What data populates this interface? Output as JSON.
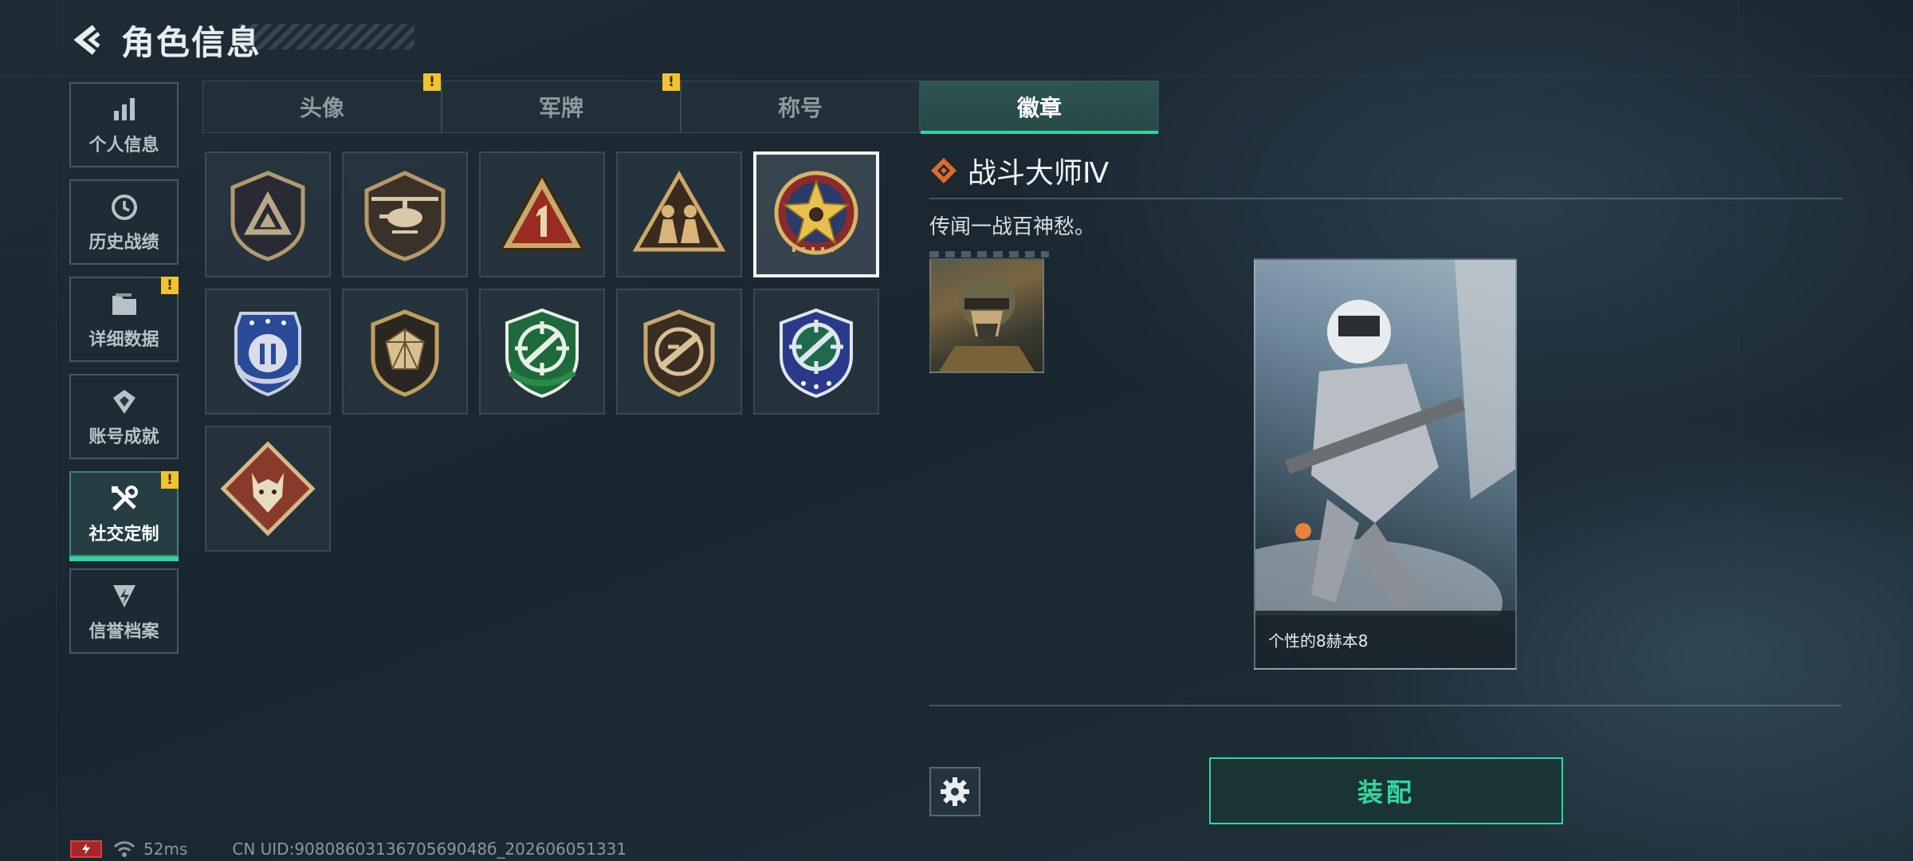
{
  "header": {
    "title": "角色信息"
  },
  "sidebar": {
    "items": [
      {
        "label": "个人信息",
        "icon": "bar-chart-icon",
        "active": false,
        "alert": false
      },
      {
        "label": "历史战绩",
        "icon": "history-clock-icon",
        "active": false,
        "alert": false
      },
      {
        "label": "详细数据",
        "icon": "folder-icon",
        "active": false,
        "alert": true
      },
      {
        "label": "账号成就",
        "icon": "achievement-icon",
        "active": false,
        "alert": false
      },
      {
        "label": "社交定制",
        "icon": "tools-icon",
        "active": true,
        "alert": true
      },
      {
        "label": "信誉档案",
        "icon": "credit-shield-icon",
        "active": false,
        "alert": false
      }
    ]
  },
  "tabs": [
    {
      "label": "头像",
      "alert": true,
      "active": false
    },
    {
      "label": "军牌",
      "alert": true,
      "active": false
    },
    {
      "label": "称号",
      "alert": false,
      "active": false
    },
    {
      "label": "徽章",
      "alert": false,
      "active": true
    }
  ],
  "badges": [
    {
      "icon": "badge-shield-triangle-icon"
    },
    {
      "icon": "badge-helicopter-icon"
    },
    {
      "icon": "badge-red-triangle-one-icon"
    },
    {
      "icon": "badge-soldiers-triangle-icon"
    },
    {
      "icon": "badge-star-medal-icon",
      "selected": true
    },
    {
      "icon": "badge-blue-laurel-icon"
    },
    {
      "icon": "badge-gem-shield-icon"
    },
    {
      "icon": "badge-green-crosshair-icon"
    },
    {
      "icon": "badge-rifle-crosshair-icon"
    },
    {
      "icon": "badge-blue-crosshair-icon"
    },
    {
      "icon": "badge-wolf-diamond-icon"
    }
  ],
  "detail": {
    "title": "战斗大师Ⅳ",
    "description": "传闻一战百神愁。",
    "card_name": "个性的8赫本8"
  },
  "actions": {
    "equip_label": "装配"
  },
  "status": {
    "ping": "52ms",
    "uid": "CN UID:9080860313670569048б_202606051331"
  },
  "colors": {
    "accent": "#2fd6a0",
    "alert": "#f2c230",
    "selected_border": "#f2f4f4"
  }
}
